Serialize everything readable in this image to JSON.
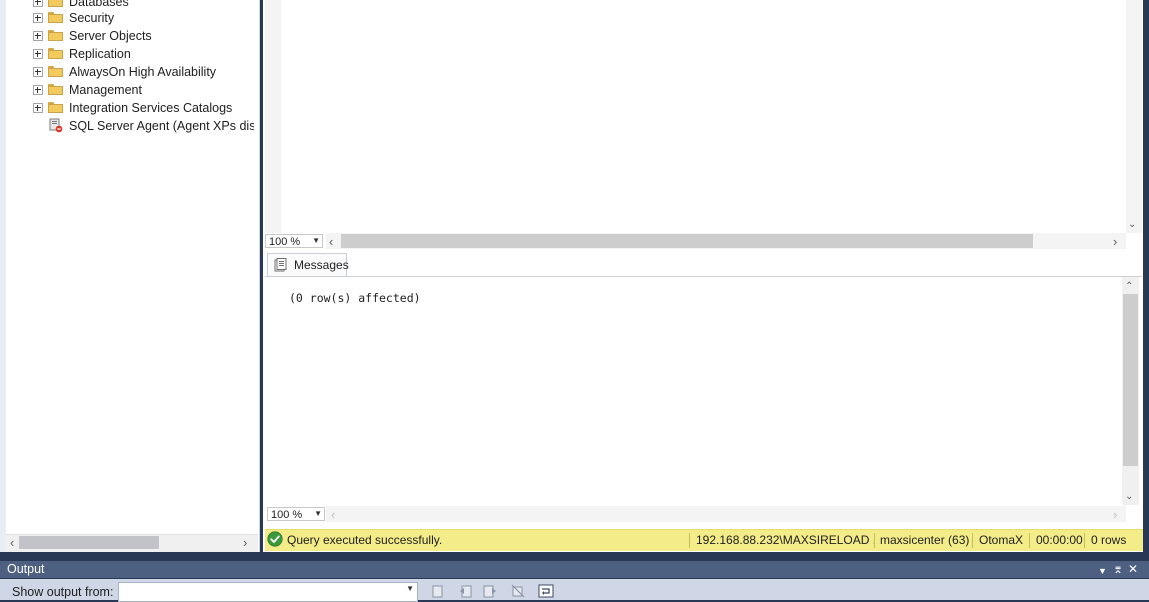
{
  "object_explorer": {
    "items": [
      {
        "label": "Databases",
        "expandable": true,
        "icon": "folder-icon"
      },
      {
        "label": "Security",
        "expandable": true,
        "icon": "folder-icon"
      },
      {
        "label": "Server Objects",
        "expandable": true,
        "icon": "folder-icon"
      },
      {
        "label": "Replication",
        "expandable": true,
        "icon": "folder-icon"
      },
      {
        "label": "AlwaysOn High Availability",
        "expandable": true,
        "icon": "folder-icon"
      },
      {
        "label": "Management",
        "expandable": true,
        "icon": "folder-icon"
      },
      {
        "label": "Integration Services Catalogs",
        "expandable": true,
        "icon": "folder-icon"
      },
      {
        "label": "SQL Server Agent (Agent XPs disabl",
        "expandable": false,
        "icon": "sql-agent-disabled-icon"
      }
    ]
  },
  "results": {
    "zoom_top": "100 %",
    "zoom_bottom": "100 %",
    "tabs": [
      {
        "label": "Messages",
        "icon": "messages-icon",
        "active": true
      }
    ],
    "message_text": "(0 row(s) affected)"
  },
  "statusbar": {
    "message": "Query executed successfully.",
    "server": "192.168.88.232\\MAXSIRELOAD ...",
    "user": "maxsicenter (63)",
    "database": "OtomaX",
    "elapsed": "00:00:00",
    "rows": "0 rows",
    "status_color": "#f3ec89"
  },
  "output_panel": {
    "title": "Output",
    "show_output_from_label": "Show output from:",
    "show_output_from_value": ""
  },
  "colors": {
    "frame": "#293955",
    "output_header": "#4d6082",
    "output_toolbar": "#cfd6e5",
    "folder": "#f2cb5c",
    "success_green": "#3c9a3c"
  }
}
